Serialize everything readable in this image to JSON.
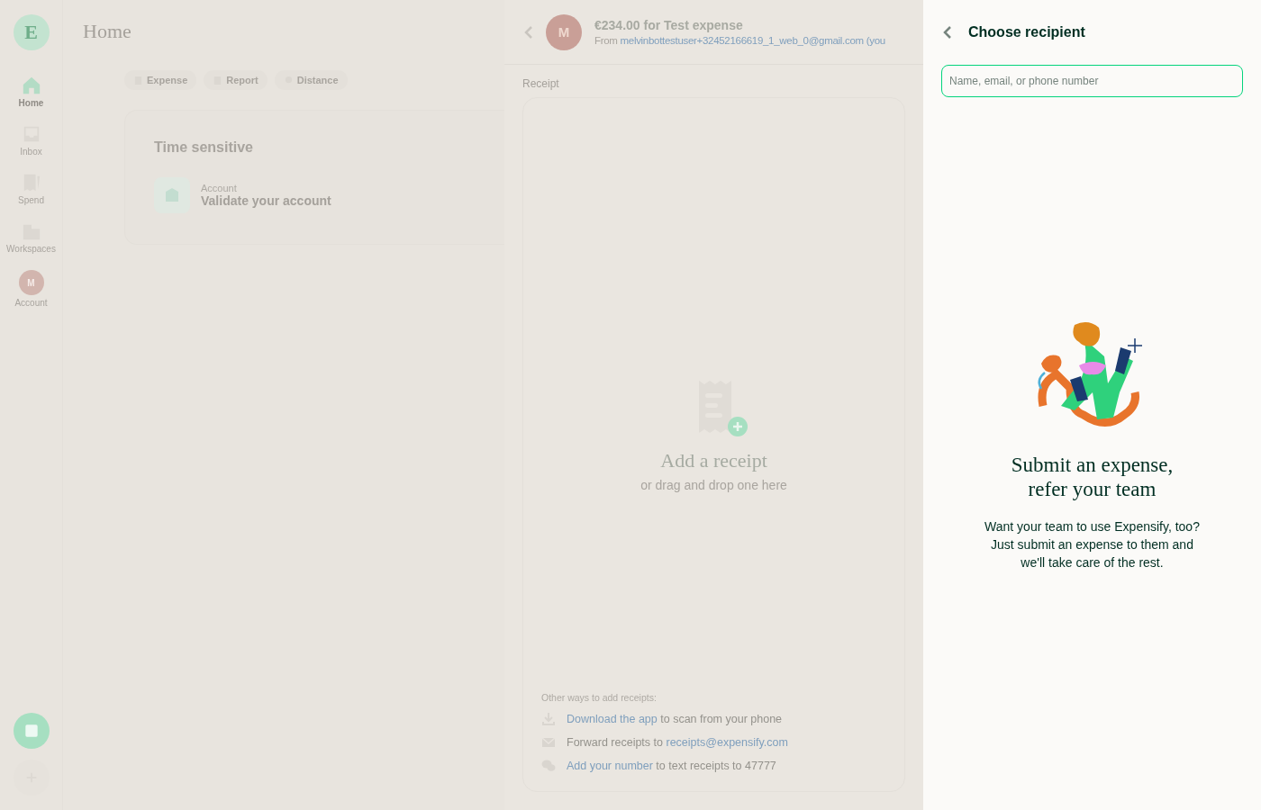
{
  "sidebar": {
    "logo": "E",
    "items": [
      {
        "kind": "home",
        "label": "Home",
        "selected": true
      },
      {
        "kind": "inbox",
        "label": "Inbox",
        "selected": false
      },
      {
        "kind": "spend",
        "label": "Spend",
        "selected": false
      },
      {
        "kind": "workspaces",
        "label": "Workspaces",
        "selected": false
      },
      {
        "kind": "account",
        "label": "Account",
        "avatar": "M",
        "selected": false
      }
    ]
  },
  "home": {
    "title": "Home",
    "actions": [
      {
        "kind": "expense",
        "label": "Expense"
      },
      {
        "kind": "report",
        "label": "Report"
      },
      {
        "kind": "distance",
        "label": "Distance"
      }
    ],
    "section": {
      "title": "Time sensitive",
      "items": [
        {
          "category": "Account",
          "title": "Validate your account"
        }
      ]
    }
  },
  "expense_panel": {
    "avatar": "M",
    "title": "€234.00 for Test expense",
    "from_label": "From",
    "from_email": "melvinbottestuser+32452166619_1_web_0@gmail.com",
    "from_suffix": "(you",
    "receipt_label": "Receipt",
    "dropzone": {
      "title": "Add a receipt",
      "subtitle": "or drag and drop one here"
    },
    "other_ways": {
      "heading": "Other ways to add receipts:",
      "items": [
        {
          "kind": "download",
          "parts": [
            {
              "text": "Download the app",
              "link": true
            },
            {
              "text": " to scan from your phone",
              "link": false
            }
          ]
        },
        {
          "kind": "email",
          "parts": [
            {
              "text": "Forward receipts to ",
              "link": false
            },
            {
              "text": "receipts@expensify.com",
              "link": true
            }
          ]
        },
        {
          "kind": "chat",
          "parts": [
            {
              "text": "Add your number",
              "link": true
            },
            {
              "text": " to text receipts to 47777",
              "link": false
            }
          ]
        }
      ]
    }
  },
  "recipient_panel": {
    "title": "Choose recipient",
    "search": {
      "placeholder": "Name, email, or phone number"
    },
    "empty_state": {
      "title": "Submit an expense, refer your team",
      "body": "Want your team to use Expensify, too? Just submit an expense to them and we'll take care of the rest."
    }
  }
}
